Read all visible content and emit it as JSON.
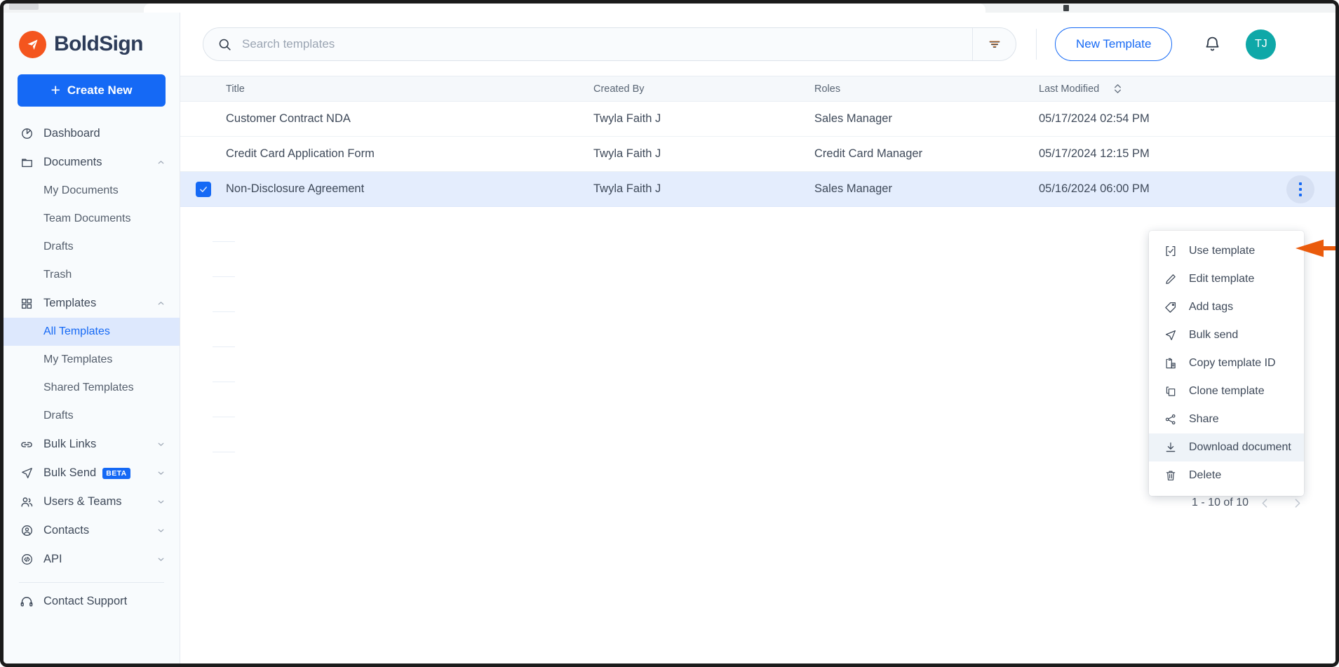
{
  "brand": {
    "name": "BoldSign",
    "logo_icon": "boldsign-paper-plane-icon",
    "accent": "#f4551e"
  },
  "sidebar": {
    "create_new": {
      "label": "Create New",
      "icon": "plus-icon"
    },
    "items": [
      {
        "label": "Dashboard",
        "icon": "pie-chart-icon",
        "expandable": false
      },
      {
        "label": "Documents",
        "icon": "folder-icon",
        "expandable": true,
        "chevron": "chevron-up-icon"
      },
      {
        "label": "My Documents",
        "sub": true
      },
      {
        "label": "Team Documents",
        "sub": true
      },
      {
        "label": "Drafts",
        "sub": true
      },
      {
        "label": "Trash",
        "sub": true
      },
      {
        "label": "Templates",
        "icon": "grid-icon",
        "expandable": true,
        "chevron": "chevron-up-icon"
      },
      {
        "label": "All Templates",
        "sub": true,
        "active": true
      },
      {
        "label": "My Templates",
        "sub": true
      },
      {
        "label": "Shared Templates",
        "sub": true
      },
      {
        "label": "Drafts",
        "sub": true
      },
      {
        "label": "Bulk Links",
        "icon": "link-icon",
        "expandable": true,
        "chevron": "chevron-down-icon"
      },
      {
        "label": "Bulk Send",
        "icon": "send-icon",
        "expandable": true,
        "chevron": "chevron-down-icon",
        "badge": "BETA"
      },
      {
        "label": "Users & Teams",
        "icon": "users-icon",
        "expandable": true,
        "chevron": "chevron-down-icon"
      },
      {
        "label": "Contacts",
        "icon": "contact-circle-icon",
        "expandable": true,
        "chevron": "chevron-down-icon"
      },
      {
        "label": "API",
        "icon": "code-circle-icon",
        "expandable": true,
        "chevron": "chevron-down-icon"
      },
      {
        "label": "Contact Support",
        "icon": "headset-icon",
        "expandable": false
      }
    ]
  },
  "topbar": {
    "search": {
      "placeholder": "Search templates",
      "value": "",
      "icon": "search-icon"
    },
    "filter_icon": "filter-icon",
    "new_template_label": "New Template",
    "bell_icon": "bell-icon",
    "avatar_initials": "TJ",
    "avatar_color": "#0fa8a8",
    "accent": "#1569f5"
  },
  "table": {
    "columns": [
      "Title",
      "Created By",
      "Roles",
      "Last Modified"
    ],
    "sort_icon": "sort-updown-icon",
    "rows": [
      {
        "checked": false,
        "title": "Customer Contract NDA",
        "created_by": "Twyla Faith J",
        "roles": "Sales Manager",
        "last_modified": "05/17/2024 02:54 PM"
      },
      {
        "checked": false,
        "title": "Credit Card Application Form",
        "created_by": "Twyla Faith J",
        "roles": "Credit Card Manager",
        "last_modified": "05/17/2024 12:15 PM"
      },
      {
        "checked": true,
        "selected": true,
        "title": "Non-Disclosure Agreement",
        "created_by": "Twyla Faith J",
        "roles": "Sales Manager",
        "last_modified": "05/16/2024 06:00 PM"
      }
    ]
  },
  "pagination": {
    "range_label": "1 - 10 of 10",
    "prev_icon": "chevron-left-icon",
    "next_icon": "chevron-right-icon"
  },
  "context_menu": {
    "items": [
      {
        "label": "Use template",
        "icon": "check-square-bracket-icon"
      },
      {
        "label": "Edit template",
        "icon": "pencil-icon"
      },
      {
        "label": "Add tags",
        "icon": "tag-icon"
      },
      {
        "label": "Bulk send",
        "icon": "send-icon"
      },
      {
        "label": "Copy template ID",
        "icon": "clipboard-copy-icon"
      },
      {
        "label": "Clone template",
        "icon": "copy-icon"
      },
      {
        "label": "Share",
        "icon": "share-nodes-icon"
      },
      {
        "label": "Download document",
        "icon": "download-icon",
        "hovered": true
      },
      {
        "label": "Delete",
        "icon": "trash-icon"
      }
    ]
  },
  "annotation": {
    "arrow_color": "#ea5b0c",
    "points_to": "Use template"
  }
}
